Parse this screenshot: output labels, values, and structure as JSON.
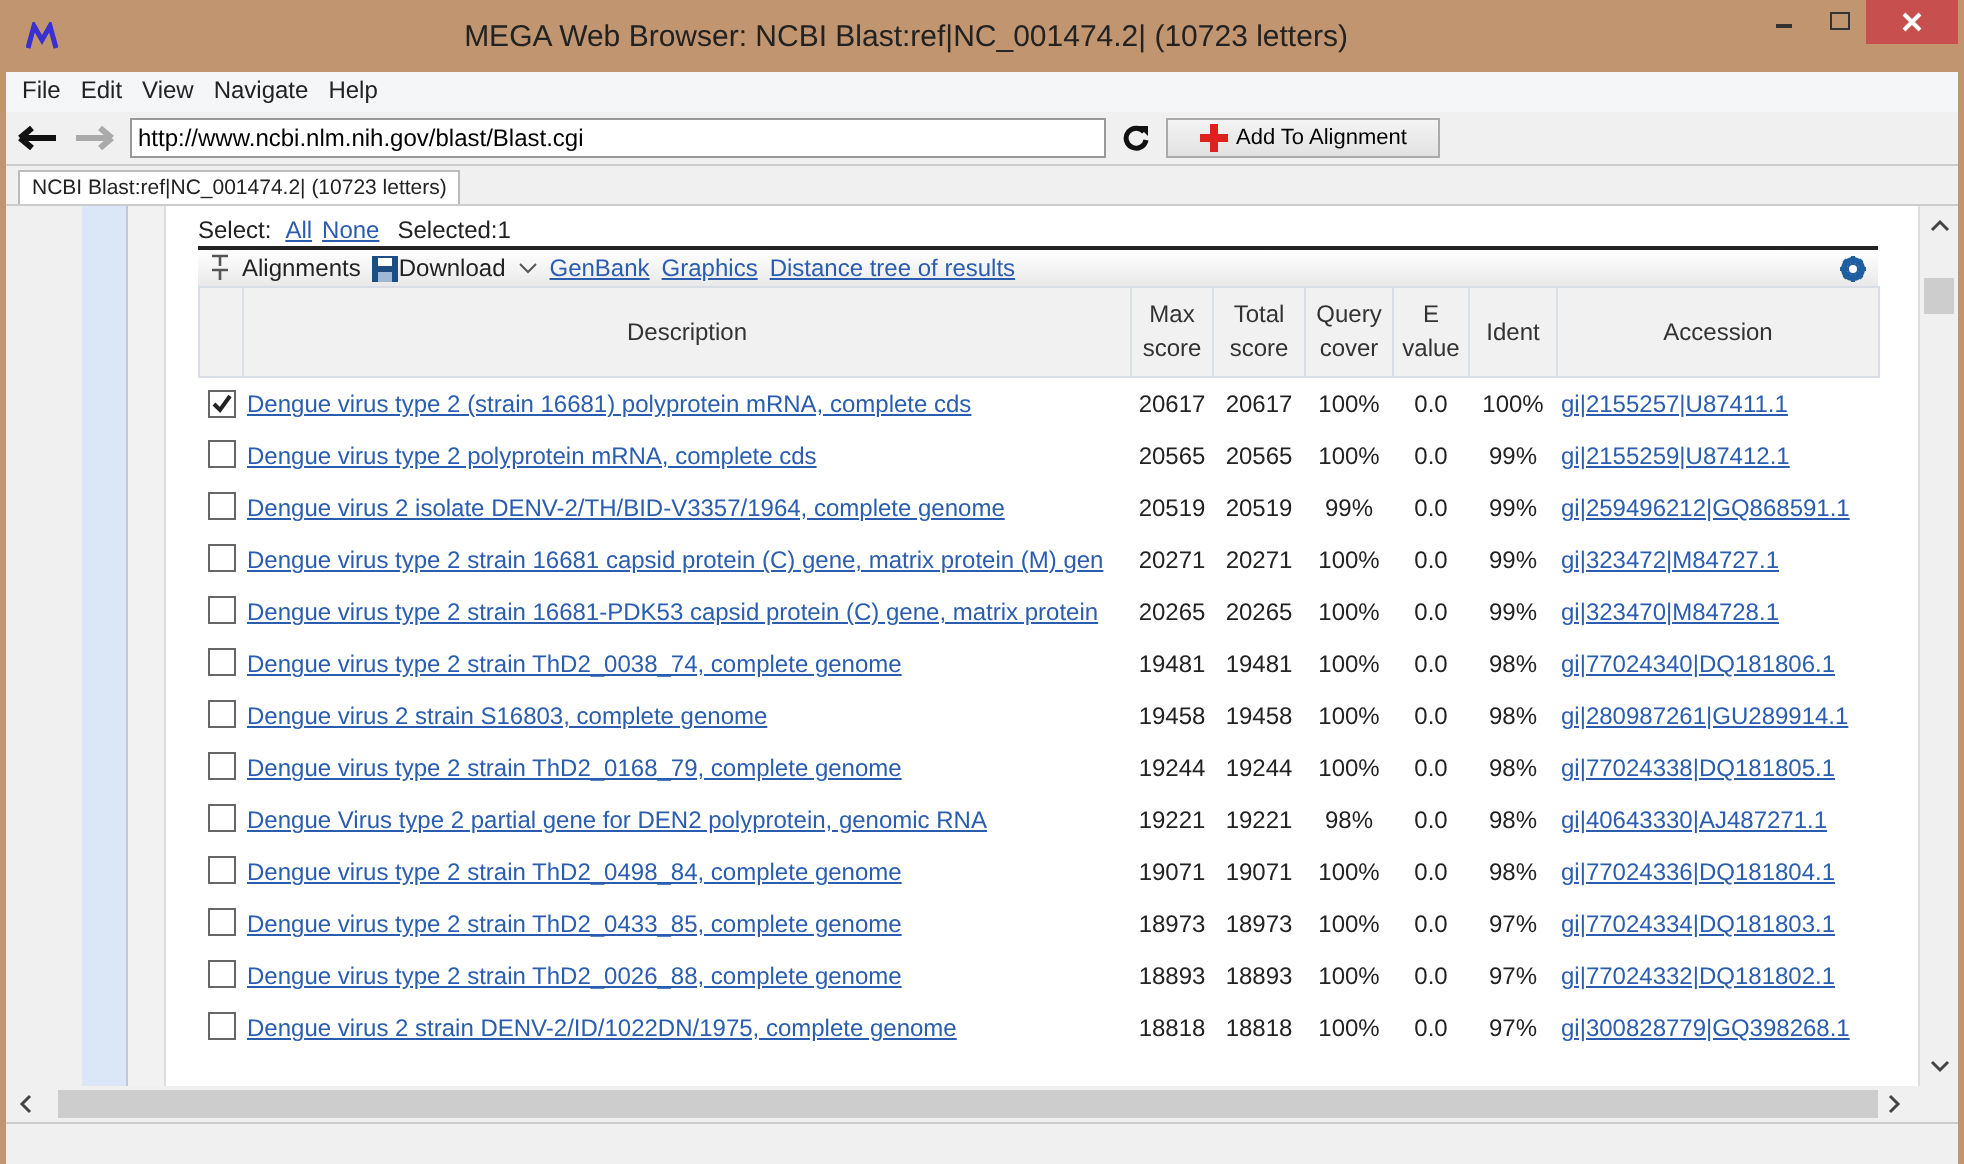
{
  "window": {
    "title": "MEGA Web Browser: NCBI Blast:ref|NC_001474.2| (10723 letters)"
  },
  "menu": [
    "File",
    "Edit",
    "View",
    "Navigate",
    "Help"
  ],
  "address": {
    "value": "http://www.ncbi.nlm.nih.gov/blast/Blast.cgi"
  },
  "add_button": "Add To Alignment",
  "tabs": [
    {
      "label": "NCBI Blast:ref|NC_001474.2| (10723 letters)",
      "selected": true
    }
  ],
  "select_bar": {
    "label": "Select:",
    "all": "All",
    "none": "None",
    "selected": "Selected:1"
  },
  "toolbar": {
    "alignments": "Alignments",
    "download": "Download",
    "links": [
      "GenBank",
      "Graphics",
      "Distance tree of results"
    ]
  },
  "table": {
    "columns": [
      "Description",
      "Max score",
      "Total score",
      "Query cover",
      "E value",
      "Ident",
      "Accession"
    ],
    "rows": [
      {
        "checked": true,
        "description": "Dengue virus type 2 (strain 16681) polyprotein mRNA, complete cds",
        "max_score": "20617",
        "total_score": "20617",
        "query_cover": "100%",
        "e_value": "0.0",
        "ident": "100%",
        "accession": "gi|2155257|U87411.1"
      },
      {
        "checked": false,
        "description": "Dengue virus type 2 polyprotein mRNA, complete cds",
        "max_score": "20565",
        "total_score": "20565",
        "query_cover": "100%",
        "e_value": "0.0",
        "ident": "99%",
        "accession": "gi|2155259|U87412.1"
      },
      {
        "checked": false,
        "description": "Dengue virus 2 isolate DENV-2/TH/BID-V3357/1964, complete genome",
        "max_score": "20519",
        "total_score": "20519",
        "query_cover": "99%",
        "e_value": "0.0",
        "ident": "99%",
        "accession": "gi|259496212|GQ868591.1"
      },
      {
        "checked": false,
        "description": "Dengue virus type 2 strain 16681 capsid protein (C) gene, matrix protein (M) gen",
        "max_score": "20271",
        "total_score": "20271",
        "query_cover": "100%",
        "e_value": "0.0",
        "ident": "99%",
        "accession": "gi|323472|M84727.1"
      },
      {
        "checked": false,
        "description": "Dengue virus type 2 strain 16681-PDK53 capsid protein (C) gene, matrix protein",
        "max_score": "20265",
        "total_score": "20265",
        "query_cover": "100%",
        "e_value": "0.0",
        "ident": "99%",
        "accession": "gi|323470|M84728.1"
      },
      {
        "checked": false,
        "description": "Dengue virus type 2 strain ThD2_0038_74, complete genome",
        "max_score": "19481",
        "total_score": "19481",
        "query_cover": "100%",
        "e_value": "0.0",
        "ident": "98%",
        "accession": "gi|77024340|DQ181806.1"
      },
      {
        "checked": false,
        "description": "Dengue virus 2 strain S16803, complete genome",
        "max_score": "19458",
        "total_score": "19458",
        "query_cover": "100%",
        "e_value": "0.0",
        "ident": "98%",
        "accession": "gi|280987261|GU289914.1"
      },
      {
        "checked": false,
        "description": "Dengue virus type 2 strain ThD2_0168_79, complete genome",
        "max_score": "19244",
        "total_score": "19244",
        "query_cover": "100%",
        "e_value": "0.0",
        "ident": "98%",
        "accession": "gi|77024338|DQ181805.1"
      },
      {
        "checked": false,
        "description": "Dengue Virus type 2 partial gene for DEN2 polyprotein, genomic RNA",
        "max_score": "19221",
        "total_score": "19221",
        "query_cover": "98%",
        "e_value": "0.0",
        "ident": "98%",
        "accession": "gi|40643330|AJ487271.1"
      },
      {
        "checked": false,
        "description": "Dengue virus type 2 strain ThD2_0498_84, complete genome",
        "max_score": "19071",
        "total_score": "19071",
        "query_cover": "100%",
        "e_value": "0.0",
        "ident": "98%",
        "accession": "gi|77024336|DQ181804.1"
      },
      {
        "checked": false,
        "description": "Dengue virus type 2 strain ThD2_0433_85, complete genome",
        "max_score": "18973",
        "total_score": "18973",
        "query_cover": "100%",
        "e_value": "0.0",
        "ident": "97%",
        "accession": "gi|77024334|DQ181803.1"
      },
      {
        "checked": false,
        "description": "Dengue virus type 2 strain ThD2_0026_88, complete genome",
        "max_score": "18893",
        "total_score": "18893",
        "query_cover": "100%",
        "e_value": "0.0",
        "ident": "97%",
        "accession": "gi|77024332|DQ181802.1"
      },
      {
        "checked": false,
        "description": "Dengue virus 2 strain DENV-2/ID/1022DN/1975, complete genome",
        "max_score": "18818",
        "total_score": "18818",
        "query_cover": "100%",
        "e_value": "0.0",
        "ident": "97%",
        "accession": "gi|300828779|GQ398268.1"
      }
    ]
  }
}
